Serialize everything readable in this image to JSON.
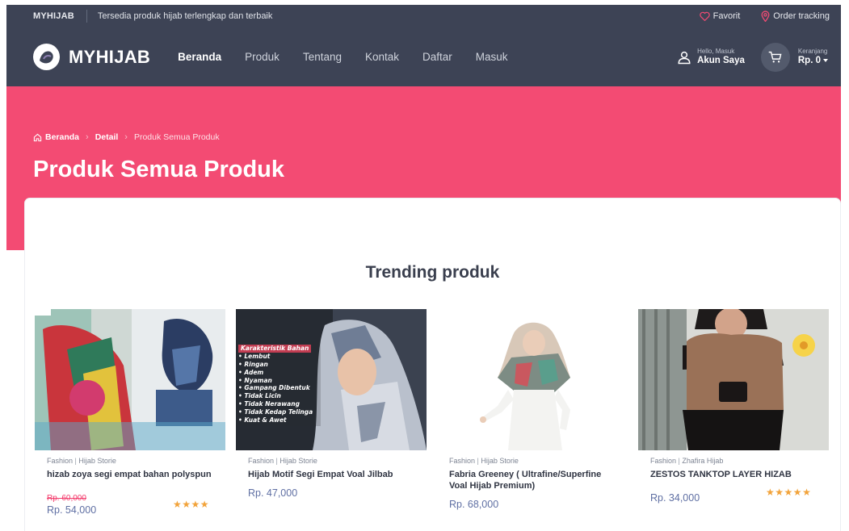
{
  "topbar": {
    "brand": "MYHIJAB",
    "tagline": "Tersedia produk hijab terlengkap dan terbaik",
    "favorite_label": "Favorit",
    "order_tracking_label": "Order tracking"
  },
  "navbar": {
    "logo_text": "MYHIJAB",
    "menu": [
      {
        "label": "Beranda",
        "active": true
      },
      {
        "label": "Produk"
      },
      {
        "label": "Tentang"
      },
      {
        "label": "Kontak"
      },
      {
        "label": "Daftar"
      },
      {
        "label": "Masuk"
      }
    ],
    "account": {
      "greeting": "Hello, Masuk",
      "label": "Akun Saya"
    },
    "cart": {
      "label": "Keranjang",
      "total": "Rp. 0"
    }
  },
  "hero": {
    "breadcrumbs": [
      "Beranda",
      "Detail",
      "Produk Semua Produk"
    ],
    "title": "Produk Semua Produk"
  },
  "trending": {
    "title": "Trending produk",
    "products": [
      {
        "category": "Fashion",
        "brand": "Hijab Storie",
        "name": "hizab zoya segi empat bahan polyspun",
        "old_price": "Rp. 60,000",
        "price": "Rp. 54,000",
        "rating": 4
      },
      {
        "category": "Fashion",
        "brand": "Hijab Storie",
        "name": "Hijab Motif Segi Empat Voal Jilbab",
        "price": "Rp. 47,000",
        "image_caption": "Karakteristik Bahan",
        "image_features": [
          "Lembut",
          "Ringan",
          "Adem",
          "Nyaman",
          "Gampang Dibentuk",
          "Tidak Licin",
          "Tidak Nerawang",
          "Tidak Kedap Telinga",
          "Kuat & Awet"
        ]
      },
      {
        "category": "Fashion",
        "brand": "Hijab Storie",
        "name": "Fabria Greeney ( Ultrafine/Superfine Voal Hijab Premium)",
        "price": "Rp. 68,000"
      },
      {
        "category": "Fashion",
        "brand": "Zhafira Hijab",
        "name": "ZESTOS TANKTOP LAYER HIZAB",
        "price": "Rp. 34,000",
        "rating": 5
      }
    ]
  },
  "colors": {
    "header_bg": "#3d4355",
    "hero_bg": "#f34b73",
    "accent_pink": "#f3396a",
    "price_blue": "#5f6fa3",
    "star": "#f2a33a"
  }
}
